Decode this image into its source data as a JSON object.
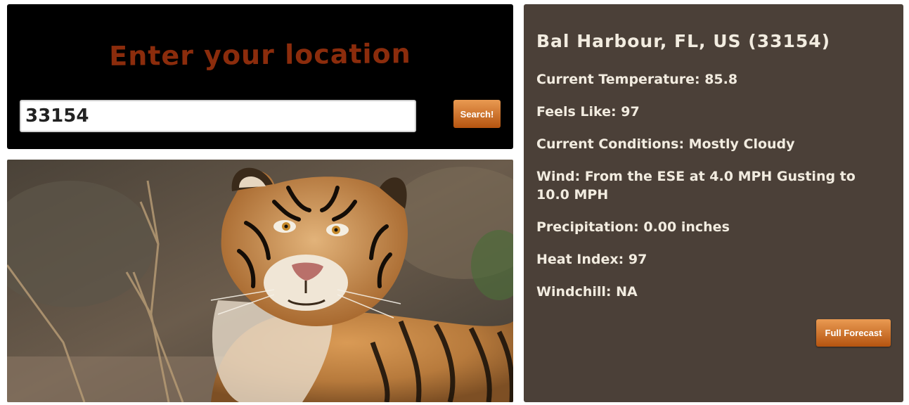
{
  "search": {
    "title": "Enter your location",
    "input_value": "33154",
    "button_label": "Search!"
  },
  "image": {
    "subject": "tiger"
  },
  "weather": {
    "location": "Bal Harbour, FL, US (33154)",
    "lines": [
      "Current Temperature: 85.8",
      "Feels Like: 97",
      "Current Conditions: Mostly Cloudy",
      "Wind: From the ESE at 4.0 MPH Gusting to 10.0 MPH",
      "Precipitation: 0.00 inches",
      "Heat Index: 97",
      "Windchill: NA"
    ],
    "forecast_button_label": "Full Forecast"
  },
  "colors": {
    "search_panel_bg": "#000000",
    "title_color": "#8b2c0c",
    "weather_panel_bg": "#4b4038",
    "weather_text": "#f2ece0",
    "button_top": "#e99a52",
    "button_bottom": "#b55410"
  }
}
